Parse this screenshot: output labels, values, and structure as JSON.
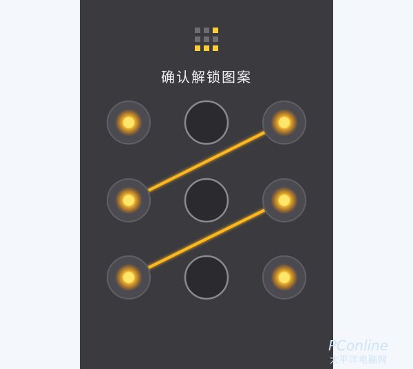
{
  "lock_screen": {
    "title": "确认解锁图案",
    "grid_icon": {
      "name": "pattern-grid-icon",
      "active_cells": [
        2,
        6,
        7,
        8
      ]
    },
    "pattern": {
      "dots": [
        {
          "id": 1,
          "selected": true
        },
        {
          "id": 2,
          "selected": false
        },
        {
          "id": 3,
          "selected": true
        },
        {
          "id": 4,
          "selected": true
        },
        {
          "id": 5,
          "selected": false
        },
        {
          "id": 6,
          "selected": true
        },
        {
          "id": 7,
          "selected": true
        },
        {
          "id": 8,
          "selected": false
        },
        {
          "id": 9,
          "selected": true
        }
      ],
      "sequence": [
        1,
        3,
        4,
        6,
        7,
        9
      ]
    }
  },
  "watermark": {
    "main": "PConline",
    "sub": "太平洋电脑网"
  },
  "colors": {
    "background": "#f4f7fb",
    "panel": "#3a3a3f",
    "accent": "#ffcf3a",
    "line": "#ffb81f",
    "inactive_dot": "#2a2a2f"
  }
}
